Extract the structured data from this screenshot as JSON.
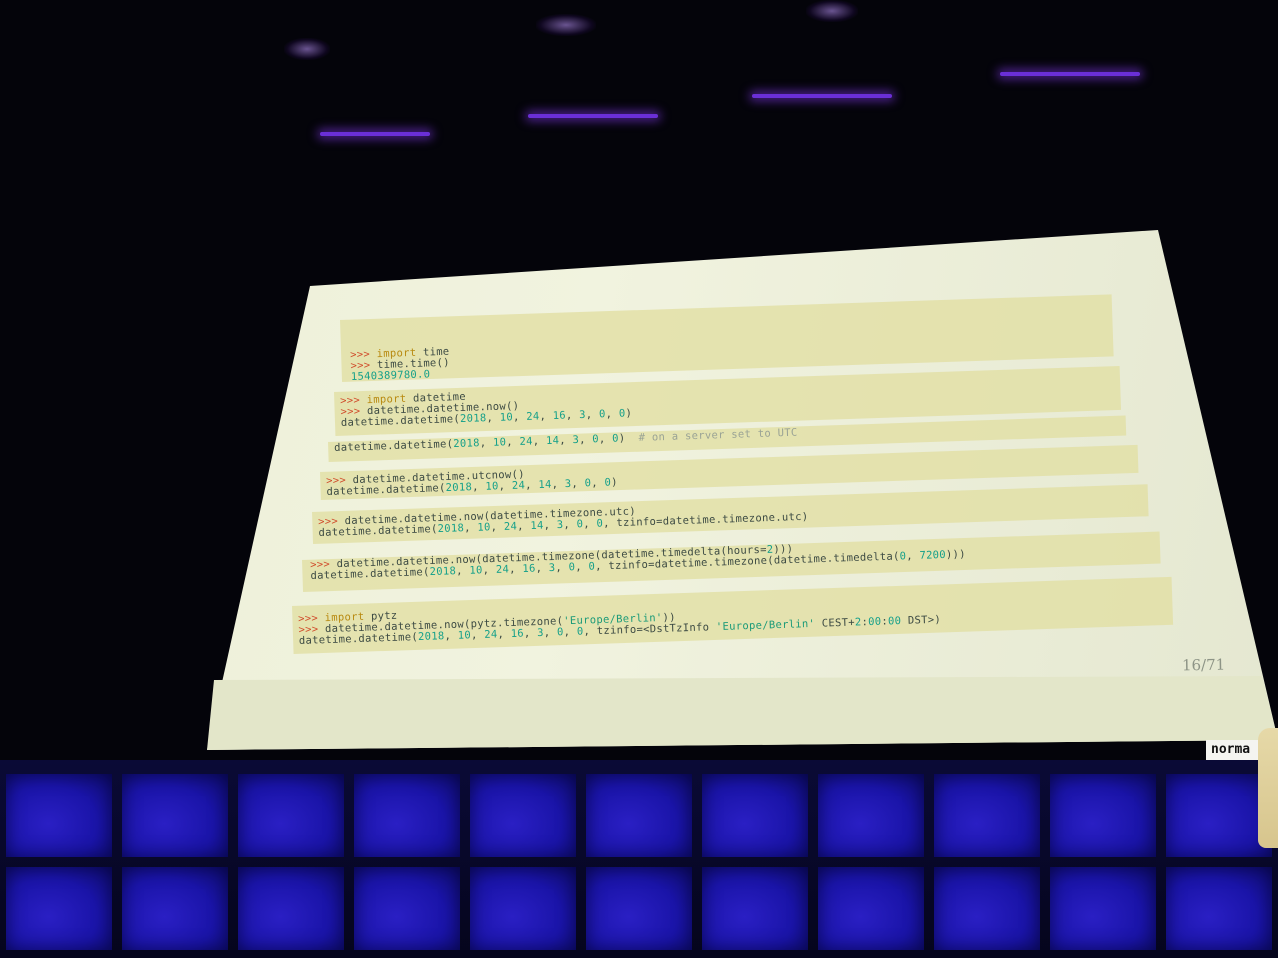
{
  "slide": {
    "blocks": [
      {
        "lines": [
          [
            {
              "t": ">>> ",
              "c": "prompt"
            },
            {
              "t": "import",
              "c": "kw"
            },
            {
              "t": " time",
              "c": "plain"
            }
          ],
          [
            {
              "t": ">>> ",
              "c": "prompt"
            },
            {
              "t": "time.time()",
              "c": "plain"
            }
          ],
          [
            {
              "t": "1540389780.0",
              "c": "num"
            }
          ]
        ]
      },
      {
        "lines": [
          [
            {
              "t": ">>> ",
              "c": "prompt"
            },
            {
              "t": "import",
              "c": "kw"
            },
            {
              "t": " datetime",
              "c": "plain"
            }
          ],
          [
            {
              "t": ">>> ",
              "c": "prompt"
            },
            {
              "t": "datetime.datetime.now()",
              "c": "plain"
            }
          ],
          [
            {
              "t": "datetime.datetime(",
              "c": "plain"
            },
            {
              "t": "2018",
              "c": "num"
            },
            {
              "t": ", ",
              "c": "plain"
            },
            {
              "t": "10",
              "c": "num"
            },
            {
              "t": ", ",
              "c": "plain"
            },
            {
              "t": "24",
              "c": "num"
            },
            {
              "t": ", ",
              "c": "plain"
            },
            {
              "t": "16",
              "c": "num"
            },
            {
              "t": ", ",
              "c": "plain"
            },
            {
              "t": "3",
              "c": "num"
            },
            {
              "t": ", ",
              "c": "plain"
            },
            {
              "t": "0",
              "c": "num"
            },
            {
              "t": ", ",
              "c": "plain"
            },
            {
              "t": "0",
              "c": "num"
            },
            {
              "t": ")",
              "c": "plain"
            }
          ]
        ]
      },
      {
        "lines": [
          [
            {
              "t": "datetime.datetime(",
              "c": "plain"
            },
            {
              "t": "2018",
              "c": "num"
            },
            {
              "t": ", ",
              "c": "plain"
            },
            {
              "t": "10",
              "c": "num"
            },
            {
              "t": ", ",
              "c": "plain"
            },
            {
              "t": "24",
              "c": "num"
            },
            {
              "t": ", ",
              "c": "plain"
            },
            {
              "t": "14",
              "c": "num"
            },
            {
              "t": ", ",
              "c": "plain"
            },
            {
              "t": "3",
              "c": "num"
            },
            {
              "t": ", ",
              "c": "plain"
            },
            {
              "t": "0",
              "c": "num"
            },
            {
              "t": ", ",
              "c": "plain"
            },
            {
              "t": "0",
              "c": "num"
            },
            {
              "t": ")  ",
              "c": "plain"
            },
            {
              "t": "# on a server set to UTC",
              "c": "cmt"
            }
          ]
        ]
      },
      {
        "lines": [
          [
            {
              "t": ">>> ",
              "c": "prompt"
            },
            {
              "t": "datetime.datetime.utcnow()",
              "c": "plain"
            }
          ],
          [
            {
              "t": "datetime.datetime(",
              "c": "plain"
            },
            {
              "t": "2018",
              "c": "num"
            },
            {
              "t": ", ",
              "c": "plain"
            },
            {
              "t": "10",
              "c": "num"
            },
            {
              "t": ", ",
              "c": "plain"
            },
            {
              "t": "24",
              "c": "num"
            },
            {
              "t": ", ",
              "c": "plain"
            },
            {
              "t": "14",
              "c": "num"
            },
            {
              "t": ", ",
              "c": "plain"
            },
            {
              "t": "3",
              "c": "num"
            },
            {
              "t": ", ",
              "c": "plain"
            },
            {
              "t": "0",
              "c": "num"
            },
            {
              "t": ", ",
              "c": "plain"
            },
            {
              "t": "0",
              "c": "num"
            },
            {
              "t": ")",
              "c": "plain"
            }
          ]
        ]
      },
      {
        "lines": [
          [
            {
              "t": ">>> ",
              "c": "prompt"
            },
            {
              "t": "datetime.datetime.now(datetime.timezone.utc)",
              "c": "plain"
            }
          ],
          [
            {
              "t": "datetime.datetime(",
              "c": "plain"
            },
            {
              "t": "2018",
              "c": "num"
            },
            {
              "t": ", ",
              "c": "plain"
            },
            {
              "t": "10",
              "c": "num"
            },
            {
              "t": ", ",
              "c": "plain"
            },
            {
              "t": "24",
              "c": "num"
            },
            {
              "t": ", ",
              "c": "plain"
            },
            {
              "t": "14",
              "c": "num"
            },
            {
              "t": ", ",
              "c": "plain"
            },
            {
              "t": "3",
              "c": "num"
            },
            {
              "t": ", ",
              "c": "plain"
            },
            {
              "t": "0",
              "c": "num"
            },
            {
              "t": ", ",
              "c": "plain"
            },
            {
              "t": "0",
              "c": "num"
            },
            {
              "t": ", tzinfo=datetime.timezone.utc)",
              "c": "plain"
            }
          ]
        ]
      },
      {
        "lines": [
          [
            {
              "t": ">>> ",
              "c": "prompt"
            },
            {
              "t": "datetime.datetime.now(datetime.timezone(datetime.timedelta(hours=",
              "c": "plain"
            },
            {
              "t": "2",
              "c": "num"
            },
            {
              "t": ")))",
              "c": "plain"
            }
          ],
          [
            {
              "t": "datetime.datetime(",
              "c": "plain"
            },
            {
              "t": "2018",
              "c": "num"
            },
            {
              "t": ", ",
              "c": "plain"
            },
            {
              "t": "10",
              "c": "num"
            },
            {
              "t": ", ",
              "c": "plain"
            },
            {
              "t": "24",
              "c": "num"
            },
            {
              "t": ", ",
              "c": "plain"
            },
            {
              "t": "16",
              "c": "num"
            },
            {
              "t": ", ",
              "c": "plain"
            },
            {
              "t": "3",
              "c": "num"
            },
            {
              "t": ", ",
              "c": "plain"
            },
            {
              "t": "0",
              "c": "num"
            },
            {
              "t": ", ",
              "c": "plain"
            },
            {
              "t": "0",
              "c": "num"
            },
            {
              "t": ", tzinfo=datetime.timezone(datetime.timedelta(",
              "c": "plain"
            },
            {
              "t": "0",
              "c": "num"
            },
            {
              "t": ", ",
              "c": "plain"
            },
            {
              "t": "7200",
              "c": "num"
            },
            {
              "t": ")))",
              "c": "plain"
            }
          ]
        ]
      },
      {
        "lines": [
          [
            {
              "t": ">>> ",
              "c": "prompt"
            },
            {
              "t": "import",
              "c": "kw"
            },
            {
              "t": " pytz",
              "c": "plain"
            }
          ],
          [
            {
              "t": ">>> ",
              "c": "prompt"
            },
            {
              "t": "datetime.datetime.now(pytz.timezone(",
              "c": "plain"
            },
            {
              "t": "'Europe/Berlin'",
              "c": "str"
            },
            {
              "t": "))",
              "c": "plain"
            }
          ],
          [
            {
              "t": "datetime.datetime(",
              "c": "plain"
            },
            {
              "t": "2018",
              "c": "num"
            },
            {
              "t": ", ",
              "c": "plain"
            },
            {
              "t": "10",
              "c": "num"
            },
            {
              "t": ", ",
              "c": "plain"
            },
            {
              "t": "24",
              "c": "num"
            },
            {
              "t": ", ",
              "c": "plain"
            },
            {
              "t": "16",
              "c": "num"
            },
            {
              "t": ", ",
              "c": "plain"
            },
            {
              "t": "3",
              "c": "num"
            },
            {
              "t": ", ",
              "c": "plain"
            },
            {
              "t": "0",
              "c": "num"
            },
            {
              "t": ", ",
              "c": "plain"
            },
            {
              "t": "0",
              "c": "num"
            },
            {
              "t": ", tzinfo=<DstTzInfo ",
              "c": "plain"
            },
            {
              "t": "'Europe/Berlin'",
              "c": "str"
            },
            {
              "t": " CEST+",
              "c": "plain"
            },
            {
              "t": "2",
              "c": "num"
            },
            {
              "t": ":",
              "c": "plain"
            },
            {
              "t": "00",
              "c": "num"
            },
            {
              "t": ":",
              "c": "plain"
            },
            {
              "t": "00",
              "c": "num"
            },
            {
              "t": " DST>)",
              "c": "plain"
            }
          ]
        ]
      }
    ],
    "page_indicator": "16/71"
  },
  "badge_text": "norma",
  "colors": {
    "prompt": "#d04a2a",
    "keyword": "#b88a10",
    "number": "#15a08a",
    "slide_background": "#f1f3df",
    "code_band": "#e2dfa5",
    "stage_tiles": "#1a14a8"
  }
}
